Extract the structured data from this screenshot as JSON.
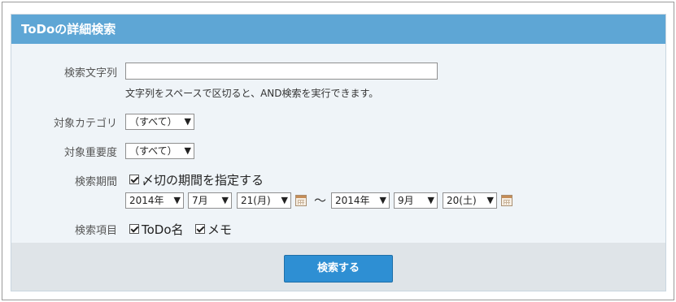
{
  "panel": {
    "title": "ToDoの詳細検索"
  },
  "keyword": {
    "label": "検索文字列",
    "value": "",
    "hint": "文字列をスペースで区切ると、AND検索を実行できます。"
  },
  "category": {
    "label": "対象カテゴリ",
    "selected": "（すべて）"
  },
  "importance": {
    "label": "対象重要度",
    "selected": "（すべて）"
  },
  "period": {
    "label": "検索期間",
    "deadline_checkbox_label": "〆切の期間を指定する",
    "deadline_checked": true,
    "from": {
      "year": "2014年",
      "month": "7月",
      "day": "21(月)"
    },
    "separator": "〜",
    "to": {
      "year": "2014年",
      "month": "9月",
      "day": "20(土)"
    }
  },
  "items": {
    "label": "検索項目",
    "todo_name": {
      "label": "ToDo名",
      "checked": true
    },
    "memo": {
      "label": "メモ",
      "checked": true
    }
  },
  "actions": {
    "search_label": "検索する"
  },
  "icons": {
    "calendar": "calendar-icon",
    "dropdown": "chevron-down-icon",
    "checkbox": "checkmark-icon"
  },
  "colors": {
    "header_bg": "#5ea6d5",
    "panel_bg": "#eff4f8",
    "footer_bg": "#dfe4e8",
    "button_bg": "#2e8fd3"
  }
}
